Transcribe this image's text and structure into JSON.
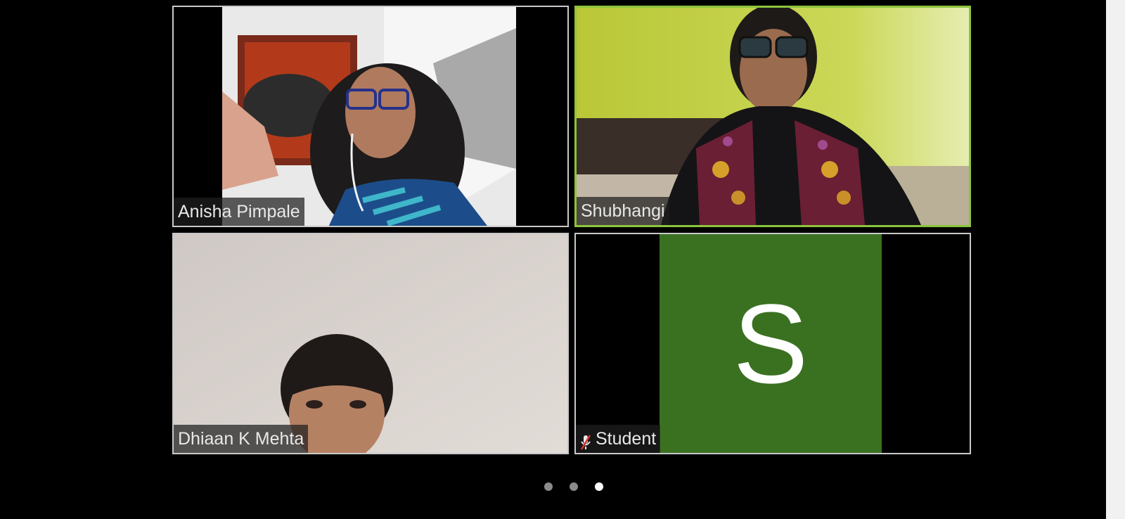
{
  "participants": [
    {
      "name": "Anisha Pimpale",
      "active": false,
      "muted": false
    },
    {
      "name": "Shubhangi",
      "active": true,
      "muted": false
    },
    {
      "name": "Dhiaan K Mehta",
      "active": false,
      "muted": false
    },
    {
      "name": "Student",
      "active": false,
      "muted": true,
      "avatar_letter": "S",
      "avatar_color": "#3a7121"
    }
  ],
  "pagination": {
    "total_pages": 3,
    "current_page": 3
  },
  "colors": {
    "active_border": "#8cc43d",
    "tile_border": "#c9c9c9",
    "background": "#000000"
  }
}
